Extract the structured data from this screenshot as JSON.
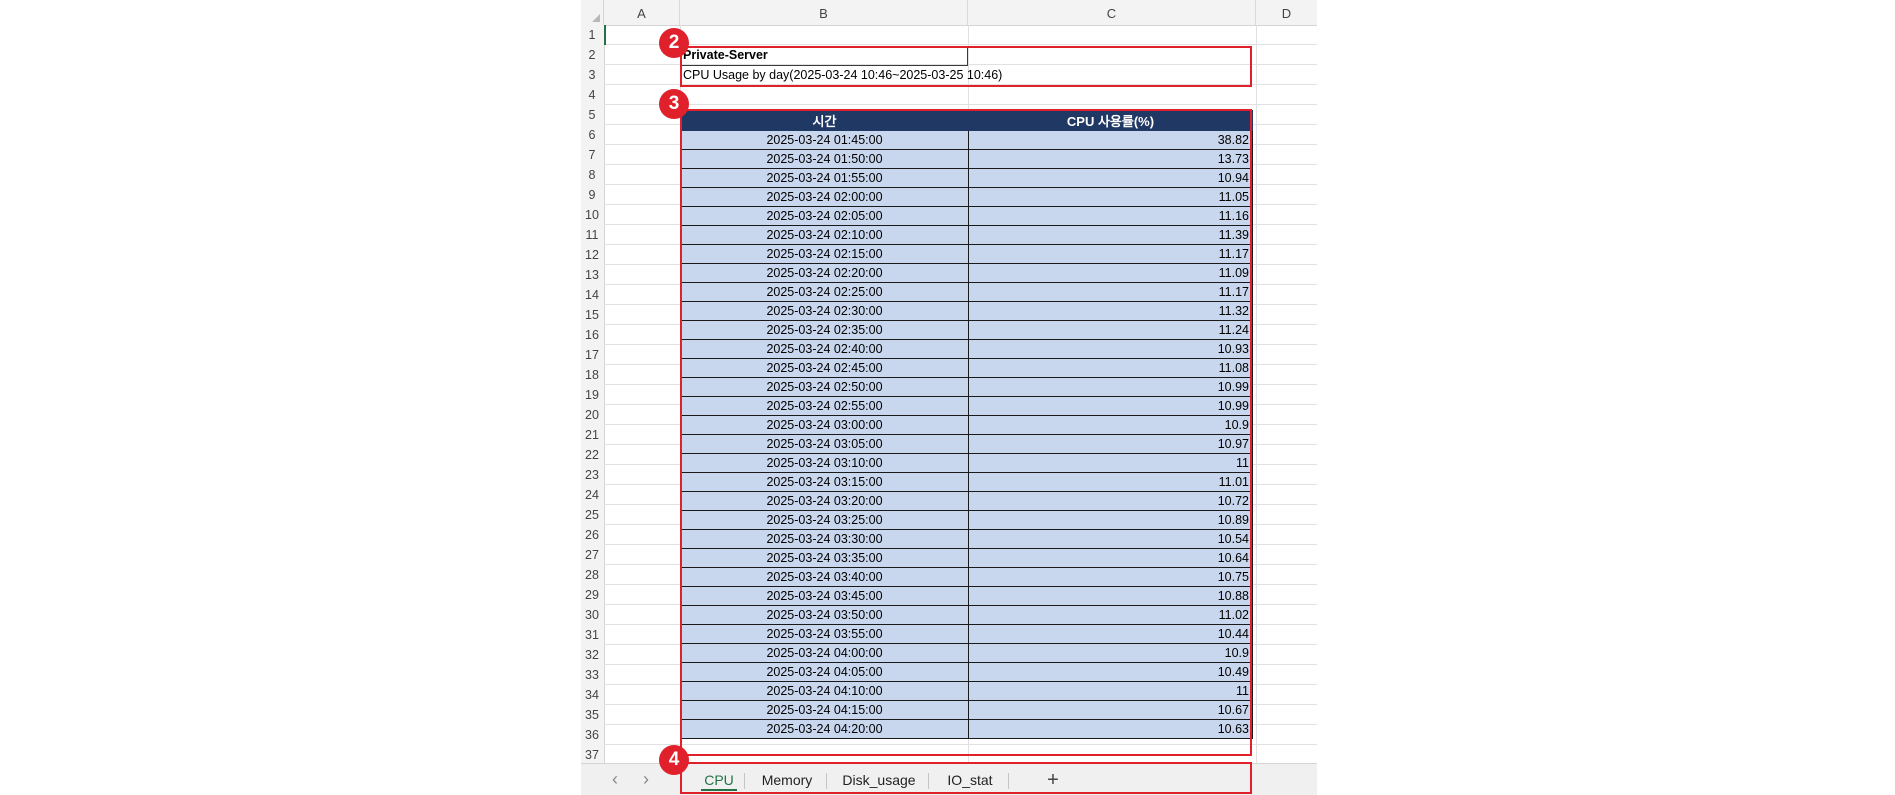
{
  "columns": [
    "A",
    "B",
    "C",
    "D"
  ],
  "rows": [
    "1",
    "2",
    "3",
    "4",
    "5",
    "6",
    "7",
    "8",
    "9",
    "10",
    "11",
    "12",
    "13",
    "14",
    "15",
    "16",
    "17",
    "18",
    "19",
    "20",
    "21",
    "22",
    "23",
    "24",
    "25",
    "26",
    "27",
    "28",
    "29",
    "30",
    "31",
    "32",
    "33",
    "34",
    "35",
    "36",
    "37"
  ],
  "title": "Private-Server",
  "subtitle": "CPU Usage by day(2025-03-24 10:46~2025-03-25 10:46)",
  "table": {
    "headers": [
      "시간",
      "CPU 사용률(%)"
    ],
    "rows": [
      [
        "2025-03-24 01:45:00",
        "38.82"
      ],
      [
        "2025-03-24 01:50:00",
        "13.73"
      ],
      [
        "2025-03-24 01:55:00",
        "10.94"
      ],
      [
        "2025-03-24 02:00:00",
        "11.05"
      ],
      [
        "2025-03-24 02:05:00",
        "11.16"
      ],
      [
        "2025-03-24 02:10:00",
        "11.39"
      ],
      [
        "2025-03-24 02:15:00",
        "11.17"
      ],
      [
        "2025-03-24 02:20:00",
        "11.09"
      ],
      [
        "2025-03-24 02:25:00",
        "11.17"
      ],
      [
        "2025-03-24 02:30:00",
        "11.32"
      ],
      [
        "2025-03-24 02:35:00",
        "11.24"
      ],
      [
        "2025-03-24 02:40:00",
        "10.93"
      ],
      [
        "2025-03-24 02:45:00",
        "11.08"
      ],
      [
        "2025-03-24 02:50:00",
        "10.99"
      ],
      [
        "2025-03-24 02:55:00",
        "10.99"
      ],
      [
        "2025-03-24 03:00:00",
        "10.9"
      ],
      [
        "2025-03-24 03:05:00",
        "10.97"
      ],
      [
        "2025-03-24 03:10:00",
        "11"
      ],
      [
        "2025-03-24 03:15:00",
        "11.01"
      ],
      [
        "2025-03-24 03:20:00",
        "10.72"
      ],
      [
        "2025-03-24 03:25:00",
        "10.89"
      ],
      [
        "2025-03-24 03:30:00",
        "10.54"
      ],
      [
        "2025-03-24 03:35:00",
        "10.64"
      ],
      [
        "2025-03-24 03:40:00",
        "10.75"
      ],
      [
        "2025-03-24 03:45:00",
        "10.88"
      ],
      [
        "2025-03-24 03:50:00",
        "11.02"
      ],
      [
        "2025-03-24 03:55:00",
        "10.44"
      ],
      [
        "2025-03-24 04:00:00",
        "10.9"
      ],
      [
        "2025-03-24 04:05:00",
        "10.49"
      ],
      [
        "2025-03-24 04:10:00",
        "11"
      ],
      [
        "2025-03-24 04:15:00",
        "10.67"
      ],
      [
        "2025-03-24 04:20:00",
        "10.63"
      ]
    ]
  },
  "badges": [
    "2",
    "3",
    "4"
  ],
  "tabs": [
    "CPU",
    "Memory",
    "Disk_usage",
    "IO_stat"
  ],
  "active_tab": "CPU",
  "nav": {
    "prev_icon": "chevron-left-icon",
    "next_icon": "chevron-right-icon",
    "add_icon": "plus-icon"
  },
  "colors": {
    "header_bg": "#1f3864",
    "cell_bg": "#c9d7ee",
    "annotation": "#e0202a",
    "excel_green": "#217346"
  }
}
